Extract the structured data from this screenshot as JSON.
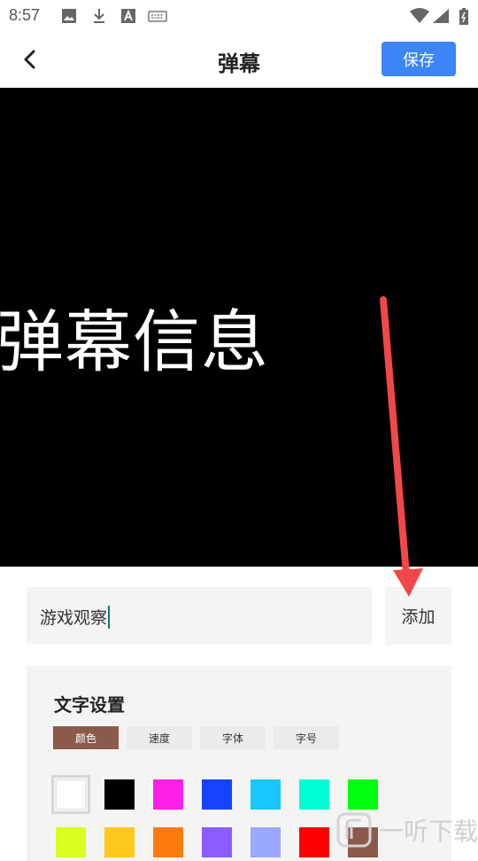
{
  "status_bar": {
    "time": "8:57",
    "icons": [
      "image-icon",
      "download-icon",
      "font-a-icon",
      "keyboard-icon",
      "wifi-icon",
      "signal-icon",
      "battery-icon"
    ]
  },
  "header": {
    "back_icon": "chevron-left-icon",
    "title": "弹幕",
    "save_label": "保存",
    "save_color": "#3d84f6"
  },
  "preview": {
    "text": "弹幕信息",
    "background": "#000000",
    "text_color": "#ffffff"
  },
  "input": {
    "value": "游戏观察",
    "add_label": "添加"
  },
  "text_settings": {
    "title": "文字设置",
    "tabs": [
      {
        "label": "颜色",
        "active": true
      },
      {
        "label": "速度",
        "active": false
      },
      {
        "label": "字体",
        "active": false
      },
      {
        "label": "字号",
        "active": false
      }
    ],
    "colors_row1": [
      "#ffffff",
      "#000000",
      "#ff1fe8",
      "#1643ff",
      "#17c7ff",
      "#00ffd5",
      "#00ff0d"
    ],
    "colors_row2": [
      "#d9ff1f",
      "#ffc81f",
      "#ff7a0d",
      "#8b5cff",
      "#9aa8ff",
      "#ff0000",
      "#8c5a4b"
    ],
    "selected_color": "#ffffff"
  },
  "watermark": {
    "text": "一听下载"
  }
}
